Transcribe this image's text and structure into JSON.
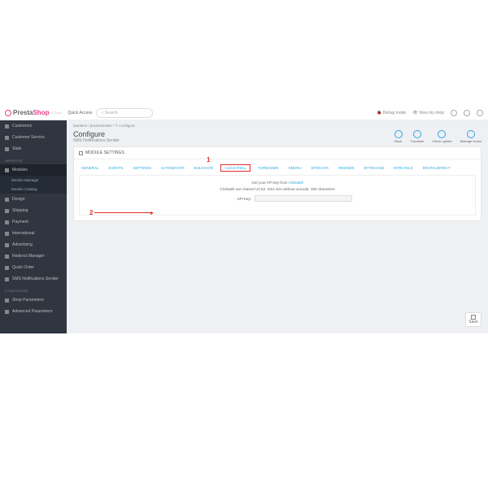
{
  "topbar": {
    "brand_a": "Presta",
    "brand_b": "Shop",
    "version": "1.7.6.x",
    "quick_access": "Quick Access",
    "search_ph": "Search",
    "debug": "Debug mode",
    "view_shop": "View my shop"
  },
  "sidebar": {
    "sell": [
      {
        "label": "Customers"
      },
      {
        "label": "Customer Service"
      },
      {
        "label": "Stats"
      }
    ],
    "improve_head": "IMPROVE",
    "improve": [
      {
        "label": "Modules",
        "sub": [
          {
            "label": "Module Manager"
          },
          {
            "label": "Module Catalog"
          }
        ]
      },
      {
        "label": "Design"
      },
      {
        "label": "Shipping"
      },
      {
        "label": "Payment"
      },
      {
        "label": "International"
      },
      {
        "label": "Advertising"
      },
      {
        "label": "Redirect Manager"
      },
      {
        "label": "Quick Order"
      },
      {
        "label": "SMS Notifications Sender"
      }
    ],
    "configure_head": "CONFIGURE",
    "configure": [
      {
        "label": "Shop Parameters"
      },
      {
        "label": "Advanced Parameters"
      }
    ]
  },
  "crumb": "Modules  /  pssmssender  /  ✎ Configure",
  "page": {
    "title": "Configure",
    "subtitle": "SMS Notifications Sender"
  },
  "actions": [
    {
      "label": "Back"
    },
    {
      "label": "Translate"
    },
    {
      "label": "Check update"
    },
    {
      "label": "Manage hooks"
    }
  ],
  "panel": {
    "head": "MODULE SETTINGS",
    "tabs": [
      "GENERAL",
      "EVENTS",
      "SETTINGS",
      "GATEWAYAPI",
      "BULKGATE",
      "CLICKATELL",
      "TURBOSMS",
      "SMSRU",
      "EPOCHTA",
      "REDSMS",
      "BYTEHAND",
      "INTELTELE",
      "DIGITALDIRECT"
    ],
    "active_tab": "CLICKATELL",
    "info1_a": "Get your API key from ",
    "info1_link": "Clickatell",
    "info2": "Clickatell use charset UCS2. Sms size without unicode: 159 characters",
    "field_label": "API Key:",
    "save": "Save"
  },
  "annotations": {
    "n1": "1",
    "n2": "2"
  }
}
